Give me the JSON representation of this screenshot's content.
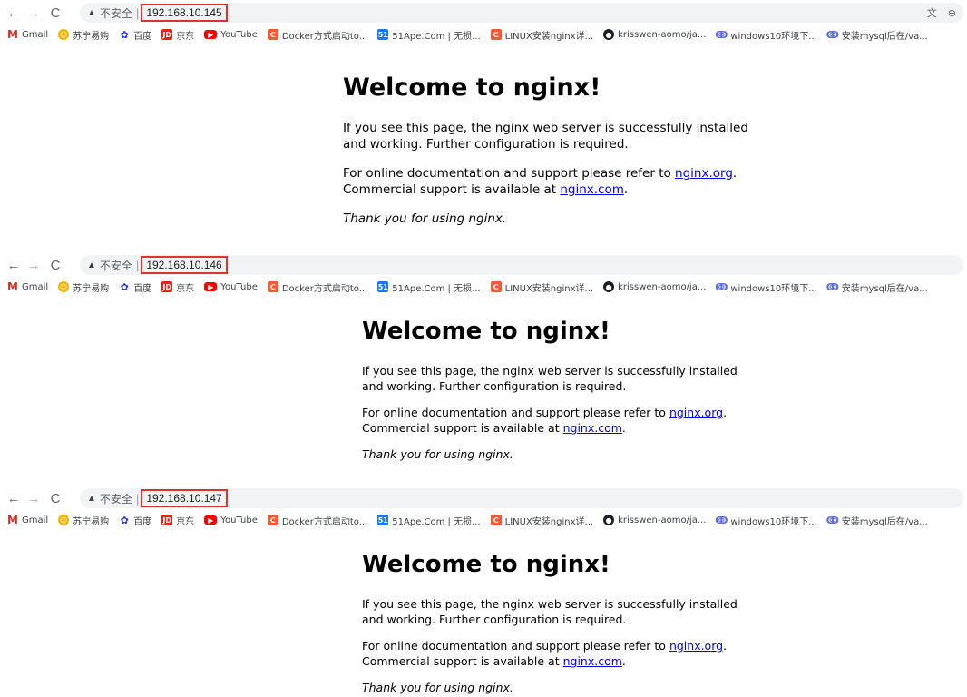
{
  "browser": {
    "insecure_label": "不安全",
    "separator": "|",
    "bookmarks": [
      {
        "label": "Gmail",
        "icon": "gmail-icon",
        "glyph": "M"
      },
      {
        "label": "苏宁易购",
        "icon": "suning-icon",
        "glyph": "☺"
      },
      {
        "label": "百度",
        "icon": "baidu-icon",
        "glyph": "✿"
      },
      {
        "label": "京东",
        "icon": "jd-icon",
        "glyph": "JD"
      },
      {
        "label": "YouTube",
        "icon": "youtube-icon",
        "glyph": "▶"
      },
      {
        "label": "Docker方式启动to...",
        "icon": "csdn-icon",
        "glyph": "C"
      },
      {
        "label": "51Ape.Com | 无损...",
        "icon": "51ape-icon",
        "glyph": "51"
      },
      {
        "label": "LINUX安装nginx详...",
        "icon": "csdn-icon",
        "glyph": "C"
      },
      {
        "label": "krisswen-aomo/ja...",
        "icon": "github-icon",
        "glyph": "●"
      },
      {
        "label": "windows10环境下...",
        "icon": "microsoft-icon",
        "glyph": "ↂ"
      },
      {
        "label": "安装mysql后在/va...",
        "icon": "microsoft-icon",
        "glyph": "ↂ"
      }
    ]
  },
  "windows": [
    {
      "url": "192.168.10.145"
    },
    {
      "url": "192.168.10.146"
    },
    {
      "url": "192.168.10.147"
    }
  ],
  "nginx": {
    "title": "Welcome to nginx!",
    "p1": "If you see this page, the nginx web server is successfully installed and working. Further configuration is required.",
    "p2_prefix": "For online documentation and support please refer to ",
    "org_link": "nginx.org",
    "p2_mid": ". Commercial support is available at ",
    "com_link": "nginx.com",
    "p2_suffix": ".",
    "thanks": "Thank you for using nginx."
  }
}
